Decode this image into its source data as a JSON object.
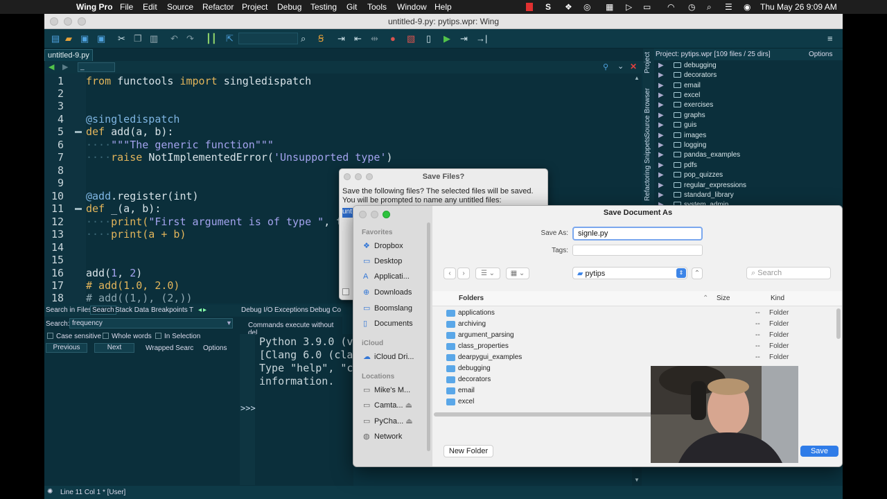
{
  "menubar": {
    "app_name": "Wing Pro",
    "items": [
      "File",
      "Edit",
      "Source",
      "Refactor",
      "Project",
      "Debug",
      "Testing",
      "Git",
      "Tools",
      "Window",
      "Help"
    ],
    "clock": "Thu May 26  9:09 AM"
  },
  "window": {
    "title": "untitled-9.py: pytips.wpr: Wing"
  },
  "editor": {
    "tab": "untitled-9.py",
    "scope_selector": "_",
    "lines": [
      "1",
      "2",
      "3",
      "4",
      "5",
      "6",
      "7",
      "8",
      "9",
      "10",
      "11",
      "12",
      "13",
      "14",
      "15",
      "16",
      "17",
      "18"
    ],
    "code": {
      "l1_kw1": "from",
      "l1_mod": "functools",
      "l1_kw2": "import",
      "l1_name": "singledispatch",
      "l4_dec": "@singledispatch",
      "l5_kw": "def",
      "l5_rest": "add(a, b):",
      "l6_str": "\"\"\"The generic function\"\"\"",
      "l7_kw": "raise",
      "l7_call": "NotImplementedError(",
      "l7_str": "'Unsupported type'",
      "l7_end": ")",
      "l10_dec": "@add",
      "l10_rest": ".register(int)",
      "l11_kw": "def",
      "l11_rest": "_(a, b):",
      "l12_call": "print(",
      "l12_str": "\"First argument is of type \"",
      "l12_rest": ", ty",
      "l13_rest": "print(a + b)",
      "l16_call": "add(",
      "l16_n1": "1",
      "l16_sep": ", ",
      "l16_n2": "2",
      "l16_end": ")",
      "l17": "# add(1.0, 2.0)",
      "l18": "# add((1,), (2,))"
    }
  },
  "project": {
    "vertical_tabs": [
      "Project",
      "Source Browser",
      "Snippets",
      "Refactoring"
    ],
    "header": "Project: pytips.wpr [109 files / 25 dirs]",
    "options": "Options",
    "items": [
      "debugging",
      "decorators",
      "email",
      "excel",
      "exercises",
      "graphs",
      "guis",
      "images",
      "logging",
      "pandas_examples",
      "pdfs",
      "pop_quizzes",
      "regular_expressions",
      "standard_library",
      "system_admin"
    ]
  },
  "search": {
    "tabs": [
      "Search in Files",
      "Search",
      "Stack Data",
      "Breakpoints",
      "T"
    ],
    "label": "Search:",
    "value": "frequency",
    "case_sensitive": "Case sensitive",
    "whole_words": "Whole words",
    "in_selection": "In Selection",
    "previous": "Previous",
    "next": "Next",
    "wrapped": "Wrapped Searc",
    "options": "Options"
  },
  "debug": {
    "tabs": [
      "Debug I/O",
      "Exceptions",
      "Debug Co"
    ],
    "hint": "Commands execute without del",
    "shell_lines": [
      "Python 3.9.0 (v3",
      "[Clang 6.0 (clar",
      "Type \"help\", \"co",
      "information."
    ],
    "prompt": ">>>"
  },
  "status": {
    "text": "Line 11 Col 1 * [User]"
  },
  "save_files_dialog": {
    "title": "Save Files?",
    "message_1": "Save the following files?  The selected files will be saved.",
    "message_2": "You will be prompted to name any untitled files:",
    "selected": "unt"
  },
  "save_as_dialog": {
    "title": "Save Document As",
    "save_as_label": "Save As:",
    "filename": "signle.py",
    "tags_label": "Tags:",
    "location": "pytips",
    "search_placeholder": "Search",
    "sidebar": {
      "favorites_header": "Favorites",
      "favorites": [
        "Dropbox",
        "Desktop",
        "Applicati...",
        "Downloads",
        "Boomslang",
        "Documents"
      ],
      "icloud_header": "iCloud",
      "icloud": [
        "iCloud Dri..."
      ],
      "locations_header": "Locations",
      "locations": [
        "Mike's M...",
        "Camta...",
        "PyCha...",
        "Network"
      ]
    },
    "columns": {
      "name": "Folders",
      "size": "Size",
      "kind": "Kind"
    },
    "rows": [
      {
        "name": "applications",
        "size": "--",
        "kind": "Folder"
      },
      {
        "name": "archiving",
        "size": "--",
        "kind": "Folder"
      },
      {
        "name": "argument_parsing",
        "size": "--",
        "kind": "Folder"
      },
      {
        "name": "class_properties",
        "size": "--",
        "kind": "Folder"
      },
      {
        "name": "dearpygui_examples",
        "size": "--",
        "kind": "Folder"
      },
      {
        "name": "debugging",
        "size": "",
        "kind": ""
      },
      {
        "name": "decorators",
        "size": "",
        "kind": ""
      },
      {
        "name": "email",
        "size": "",
        "kind": ""
      },
      {
        "name": "excel",
        "size": "",
        "kind": ""
      }
    ],
    "new_folder": "New Folder",
    "save": "Save"
  }
}
